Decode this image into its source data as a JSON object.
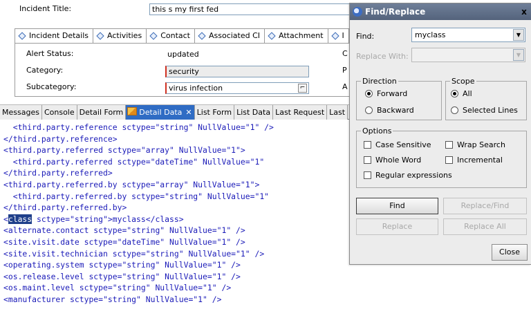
{
  "form": {
    "incident_title_label": "Incident Title:",
    "incident_title_value": "this s my first fed",
    "tabs": [
      {
        "label": "Incident Details",
        "active": true
      },
      {
        "label": "Activities"
      },
      {
        "label": "Contact"
      },
      {
        "label": "Associated CI"
      },
      {
        "label": "Attachment"
      },
      {
        "label": "I"
      }
    ],
    "alert_status_label": "Alert Status:",
    "alert_status_value": "updated",
    "category_label": "Category:",
    "category_value": "security",
    "subcategory_label": "Subcategory:",
    "subcategory_value": "virus infection",
    "right_cut_labels": [
      "C",
      "P",
      "A"
    ]
  },
  "bottom_tabs": [
    {
      "label": "Messages"
    },
    {
      "label": "Console"
    },
    {
      "label": "Detail Form"
    },
    {
      "label": "Detail Data",
      "active": true,
      "close": "✕"
    },
    {
      "label": "List Form"
    },
    {
      "label": "List Data"
    },
    {
      "label": "Last Request"
    },
    {
      "label": "Last"
    }
  ],
  "code": {
    "lines": [
      "  <third.party.reference sctype=\"string\" NullValue=\"1\" />",
      "</third.party.reference>",
      "<third.party.referred sctype=\"array\" NullValue=\"1\">",
      "  <third.party.referred sctype=\"dateTime\" NullValue=\"1\"",
      "</third.party.referred>",
      "<third.party.referred.by sctype=\"array\" NullValue=\"1\">",
      "  <third.party.referred.by sctype=\"string\" NullValue=\"1\"",
      "</third.party.referred.by>",
      "<class sctype=\"string\">myclass</class>",
      "<alternate.contact sctype=\"string\" NullValue=\"1\" />",
      "<site.visit.date sctype=\"dateTime\" NullValue=\"1\" />",
      "<site.visit.technician sctype=\"string\" NullValue=\"1\" />",
      "<operating.system sctype=\"string\" NullValue=\"1\" />",
      "<os.release.level sctype=\"string\" NullValue=\"1\" />",
      "<os.maint.level sctype=\"string\" NullValue=\"1\" />",
      "<manufacturer sctype=\"string\" NullValue=\"1\" />"
    ],
    "highlight_line_index": 8,
    "highlight_word": "class"
  },
  "dialog": {
    "title": "Find/Replace",
    "close": "x",
    "find_label": "Find:",
    "find_value": "myclass",
    "replace_label": "Replace With:",
    "replace_value": "",
    "direction_legend": "Direction",
    "direction_forward": "Forward",
    "direction_backward": "Backward",
    "scope_legend": "Scope",
    "scope_all": "All",
    "scope_selected": "Selected Lines",
    "options_legend": "Options",
    "opt_case": "Case Sensitive",
    "opt_wrap": "Wrap Search",
    "opt_whole": "Whole Word",
    "opt_incremental": "Incremental",
    "opt_regex": "Regular expressions",
    "btn_find": "Find",
    "btn_replace_find": "Replace/Find",
    "btn_replace": "Replace",
    "btn_replace_all": "Replace All",
    "btn_close": "Close",
    "combo_arrow": "▼"
  },
  "colors": {
    "code_text": "#1a1ab8",
    "highlight_bg": "#1f3f8a",
    "active_tab": "#2f6cc4",
    "dialog_title": "#5f6f88"
  }
}
